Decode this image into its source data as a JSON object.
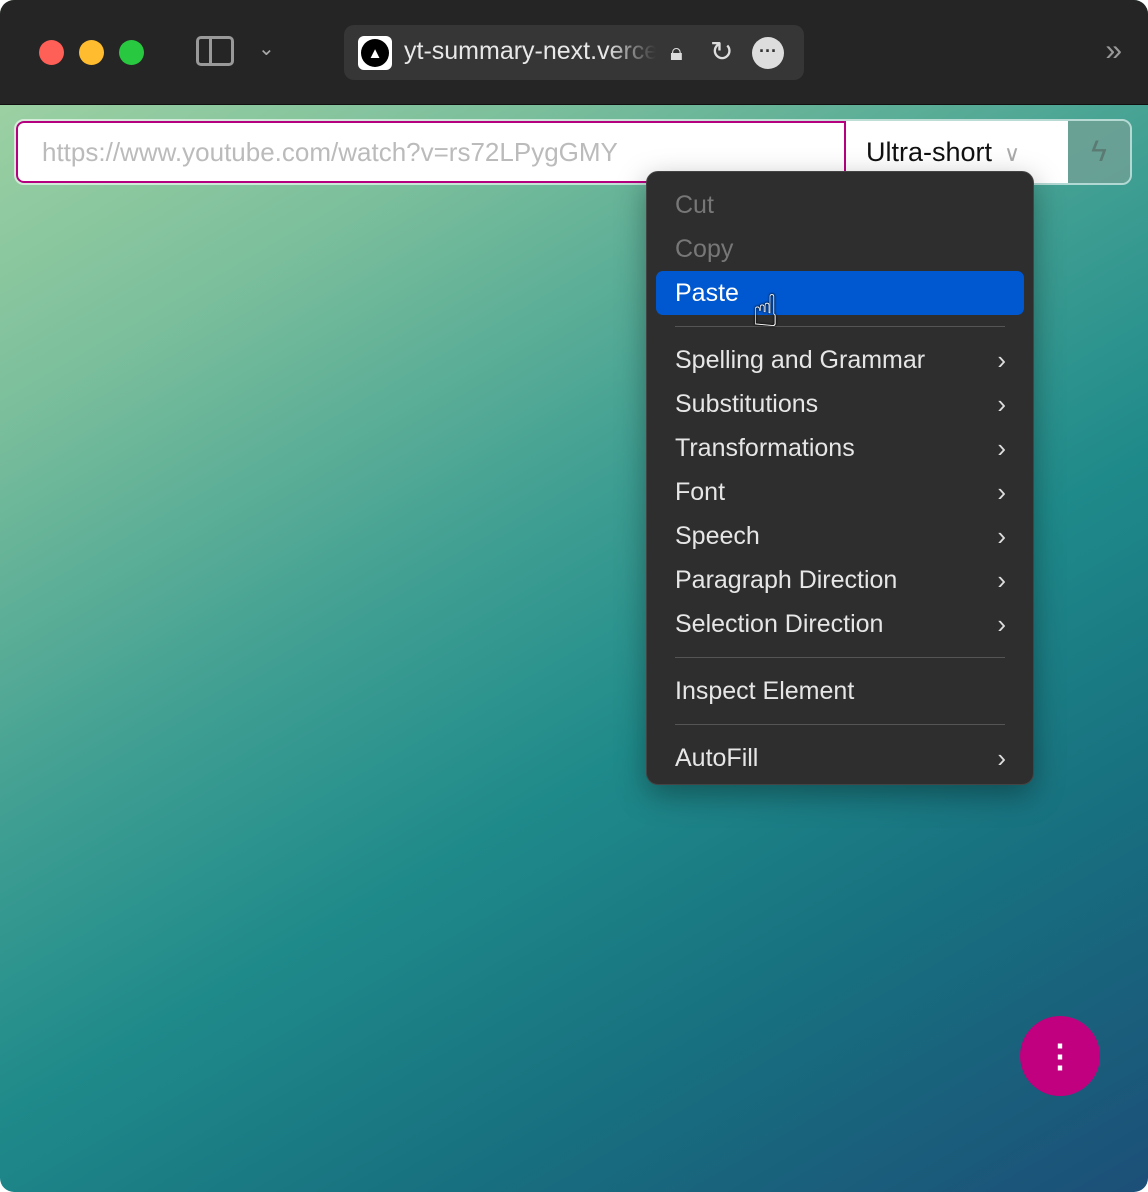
{
  "browser": {
    "host": "yt-summary-next.vercel.app",
    "colors": {
      "close": "#fe5f57",
      "minimize": "#febc2e",
      "zoom": "#28c840"
    }
  },
  "form": {
    "url_placeholder": "https://www.youtube.com/watch?v=rs72LPygGMY",
    "length_option": "Ultra-short"
  },
  "context_menu": {
    "group1": [
      {
        "label": "Cut",
        "disabled": true
      },
      {
        "label": "Copy",
        "disabled": true
      },
      {
        "label": "Paste",
        "highlighted": true
      }
    ],
    "group2": [
      {
        "label": "Spelling and Grammar"
      },
      {
        "label": "Substitutions"
      },
      {
        "label": "Transformations"
      },
      {
        "label": "Font"
      },
      {
        "label": "Speech"
      },
      {
        "label": "Paragraph Direction"
      },
      {
        "label": "Selection Direction"
      }
    ],
    "group3": [
      {
        "label": "Inspect Element"
      }
    ],
    "group4": [
      {
        "label": "AutoFill"
      }
    ]
  },
  "fab": {
    "icon": "vertical-ellipsis-icon",
    "accent": "#c0007e"
  }
}
